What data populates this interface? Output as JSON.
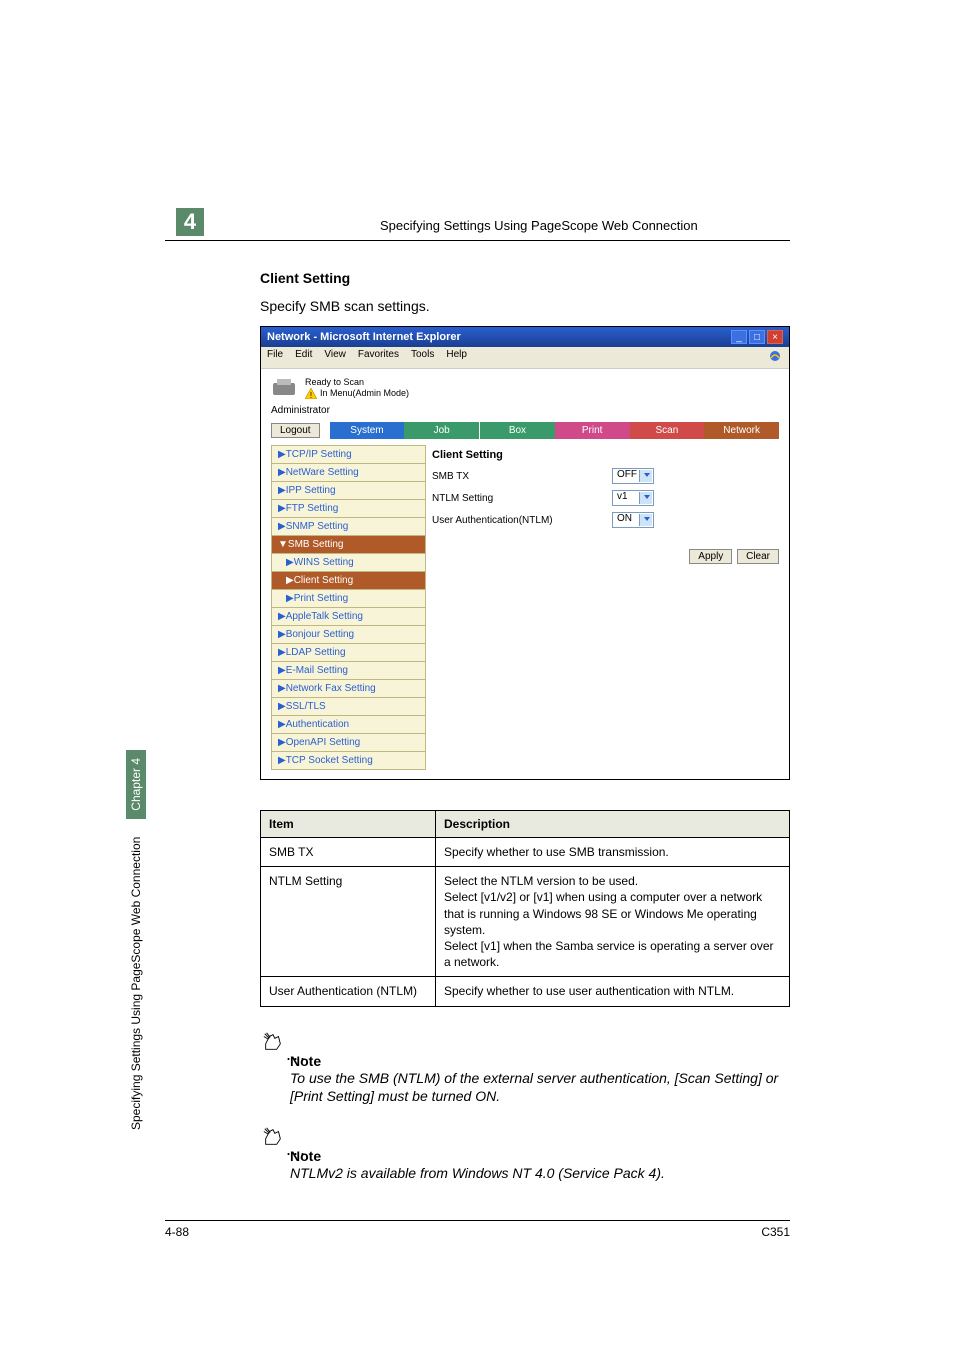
{
  "header": {
    "chapter_number": "4",
    "title": "Specifying Settings Using PageScope Web Connection"
  },
  "section": {
    "title": "Client Setting",
    "lead": "Specify SMB scan settings."
  },
  "screenshot": {
    "window_title": "Network - Microsoft Internet Explorer",
    "menu": {
      "file": "File",
      "edit": "Edit",
      "view": "View",
      "favorites": "Favorites",
      "tools": "Tools",
      "help": "Help"
    },
    "status_ready": "Ready to Scan",
    "status_menu": "In Menu(Admin Mode)",
    "admin_label": "Administrator",
    "logout": "Logout",
    "tabs": {
      "system": "System",
      "job": "Job",
      "box": "Box",
      "print": "Print",
      "scan": "Scan",
      "network": "Network"
    },
    "side": {
      "tcpip": "TCP/IP Setting",
      "netware": "NetWare Setting",
      "ipp": "IPP Setting",
      "ftp": "FTP Setting",
      "snmp": "SNMP Setting",
      "smb": "SMB Setting",
      "wins": "WINS Setting",
      "client": "Client Setting",
      "printset": "Print Setting",
      "appletalk": "AppleTalk Setting",
      "bonjour": "Bonjour Setting",
      "ldap": "LDAP Setting",
      "email": "E-Mail Setting",
      "netfax": "Network Fax Setting",
      "ssl": "SSL/TLS",
      "auth": "Authentication",
      "openapi": "OpenAPI Setting",
      "tcpsock": "TCP Socket Setting"
    },
    "form": {
      "title": "Client Setting",
      "smb_tx_label": "SMB TX",
      "smb_tx_val": "OFF",
      "ntlm_label": "NTLM Setting",
      "ntlm_val": "v1",
      "userauth_label": "User Authentication(NTLM)",
      "userauth_val": "ON",
      "apply": "Apply",
      "clear": "Clear"
    }
  },
  "table": {
    "head_item": "Item",
    "head_desc": "Description",
    "rows": [
      {
        "item": "SMB TX",
        "desc": "Specify whether to use SMB transmission."
      },
      {
        "item": "NTLM Setting",
        "desc": "Select the NTLM version to be used.\nSelect [v1/v2] or [v1] when using a computer over a network that is running a Windows 98 SE or Windows Me operating system.\nSelect [v1] when the Samba service is operating a server over a network."
      },
      {
        "item": "User Authentication (NTLM)",
        "desc": "Specify whether to use user authentication with NTLM."
      }
    ]
  },
  "notes": {
    "label1": "Note",
    "text1": "To use the SMB (NTLM) of the external server authentication, [Scan Setting] or [Print Setting] must be turned ON.",
    "label2": "Note",
    "text2": "NTLMv2 is available from Windows NT 4.0 (Service Pack 4)."
  },
  "side_label": {
    "text": "Specifying Settings Using PageScope Web Connection",
    "chapter": "Chapter 4"
  },
  "footer": {
    "page": "4-88",
    "model": "C351"
  }
}
